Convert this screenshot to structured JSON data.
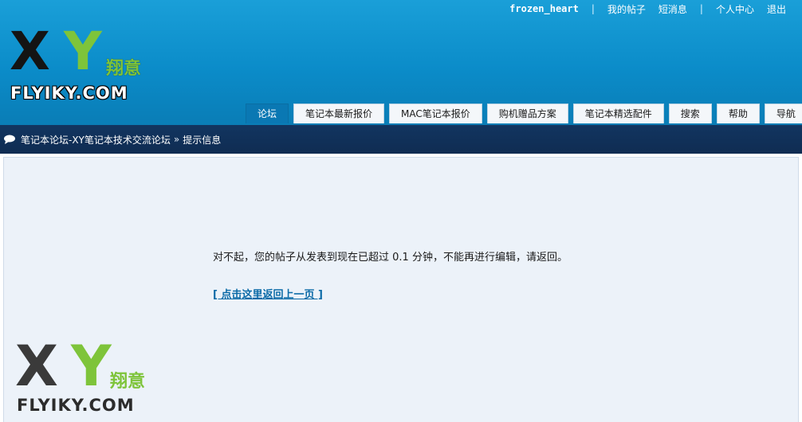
{
  "header": {
    "user": "frozen_heart",
    "links": [
      "我的帖子",
      "短消息",
      "个人中心",
      "退出"
    ],
    "logo": {
      "x": "X",
      "y": "Y",
      "cn": "翔意",
      "domain": "FLYIKY.COM"
    }
  },
  "nav": {
    "tabs": [
      "论坛",
      "笔记本最新报价",
      "MAC笔记本报价",
      "购机赠品方案",
      "笔记本精选配件",
      "搜索",
      "帮助",
      "导航"
    ]
  },
  "breadcrumb": {
    "forum": "笔记本论坛-XY笔记本技术交流论坛",
    "arrow": "»",
    "current": "提示信息"
  },
  "message": {
    "text": "对不起，您的帖子从发表到现在已超过 0.1 分钟，不能再进行编辑，请返回。",
    "back_link": "[ 点击这里返回上一页 ]"
  },
  "footer_logo": {
    "x": "X",
    "y": "Y",
    "cn": "翔意",
    "domain": "FLYIKY.COM"
  },
  "colors": {
    "header_blue": "#0b8cc9",
    "crumb_navy": "#123560",
    "accent_green": "#7ec43a"
  }
}
